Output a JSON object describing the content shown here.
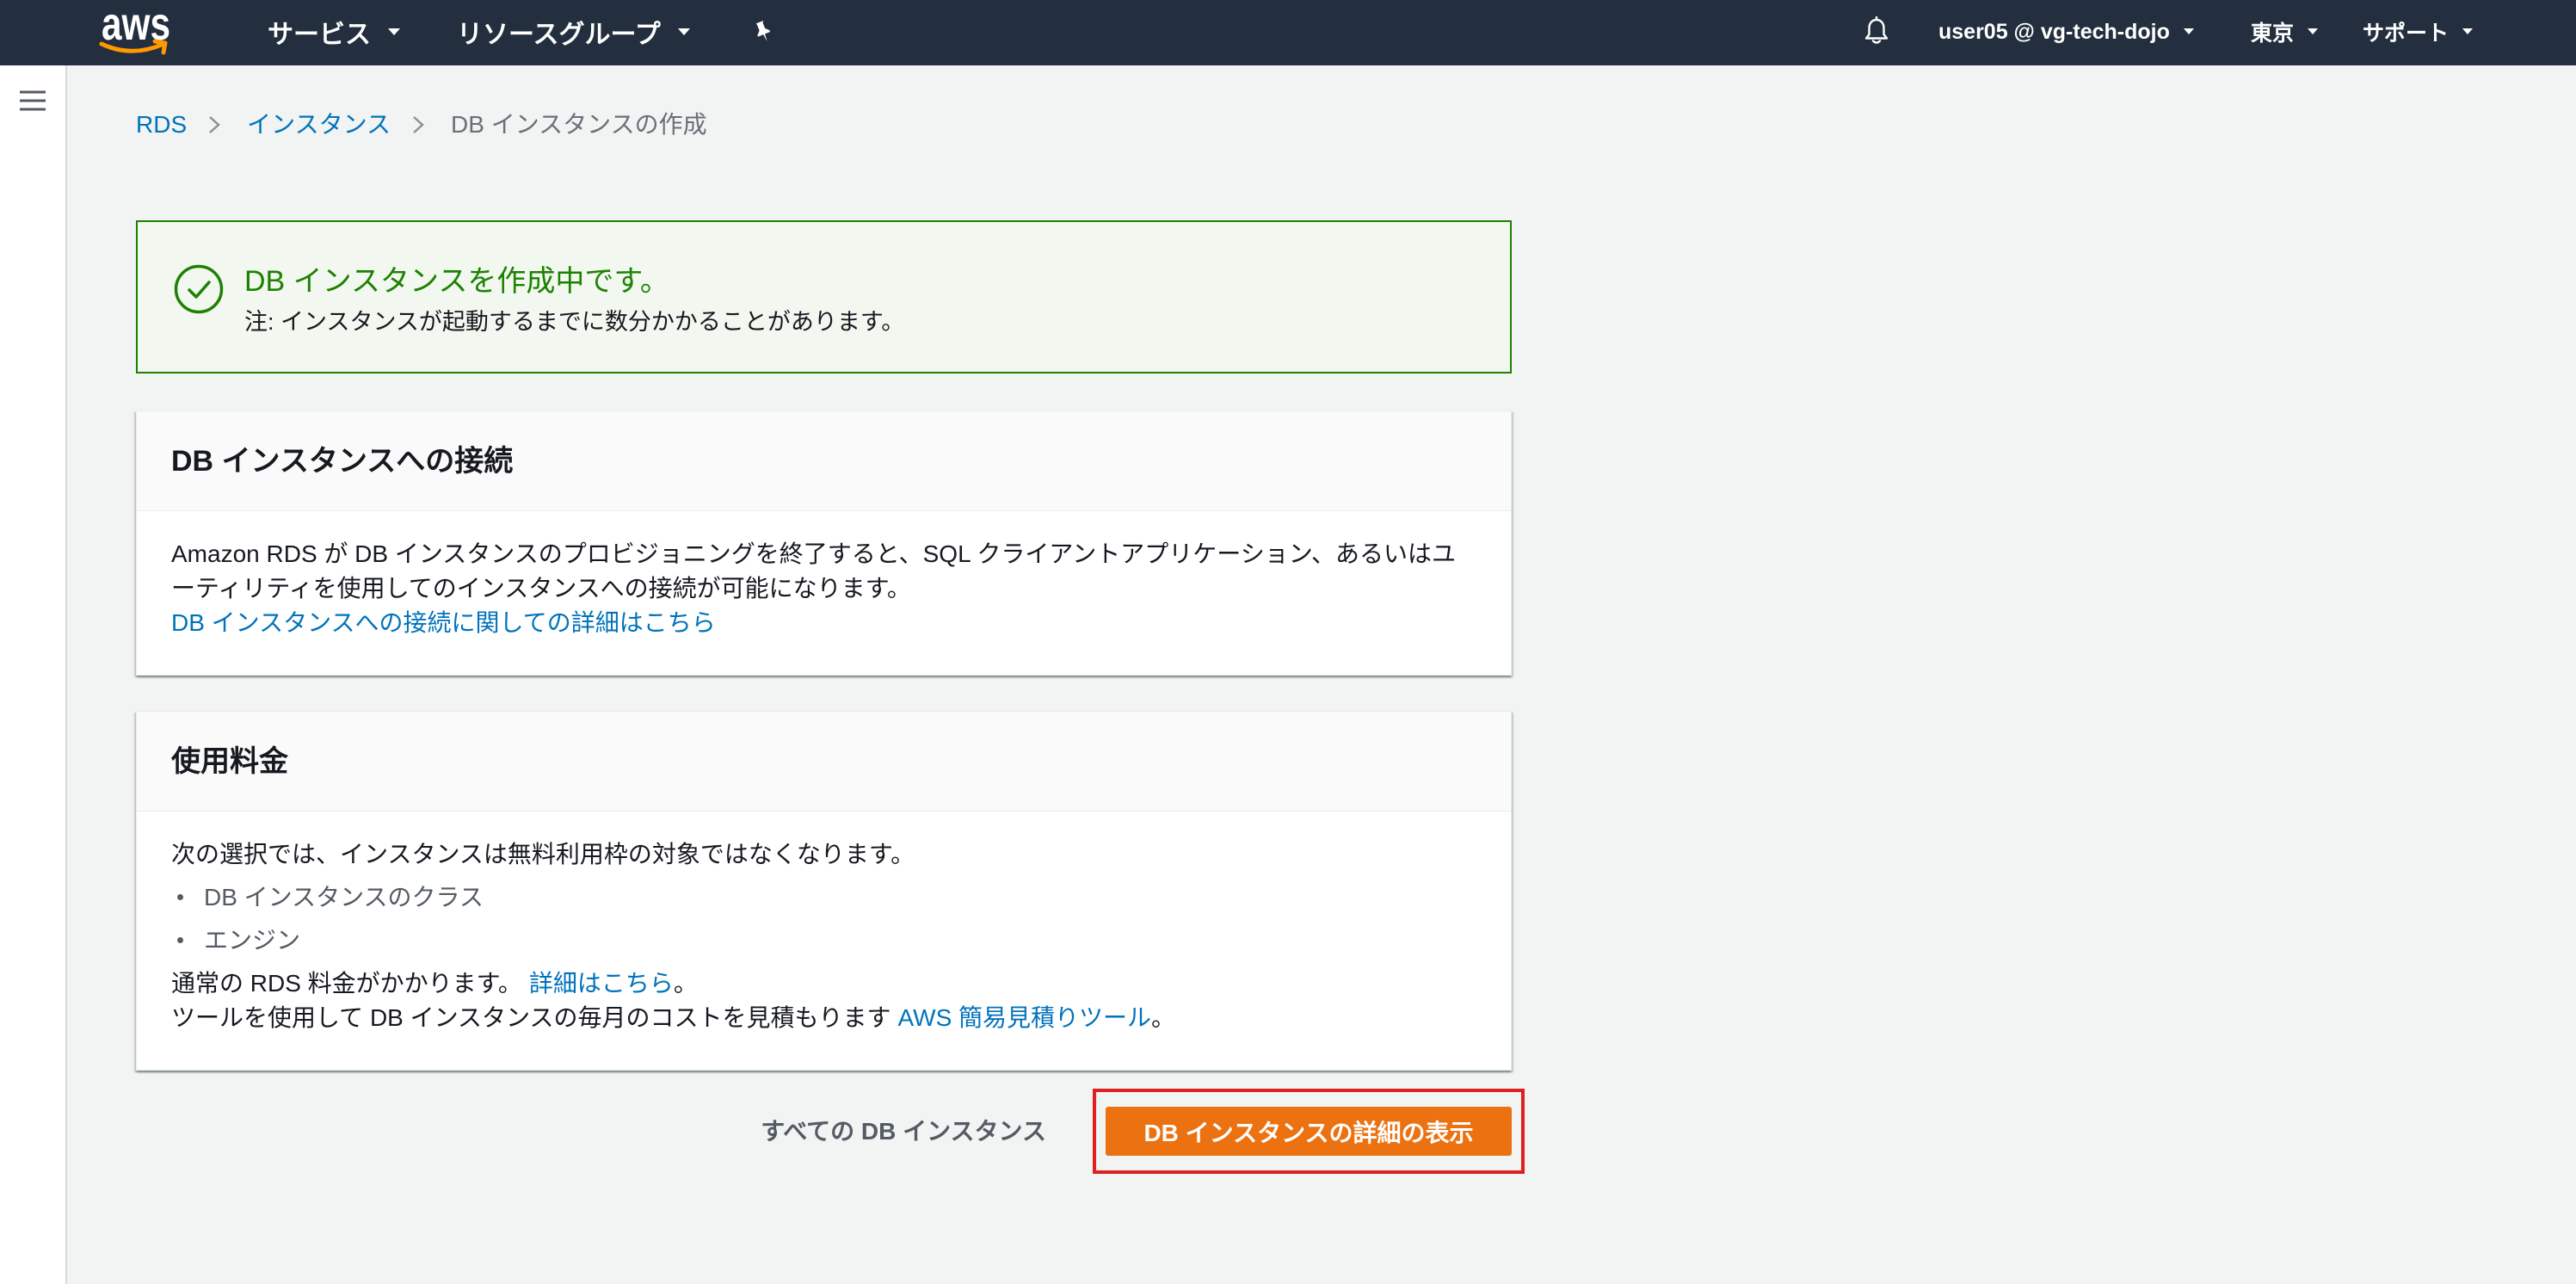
{
  "theme": {
    "nav_background": "#232f3e",
    "page_background": "#f2f3f3",
    "link": "#0073bb",
    "success": "#1d8102",
    "success_background": "#f2f8f0",
    "primary_button": "#ec7211",
    "highlight_border": "#e02020",
    "aws_logo_smile": "#ff9900"
  },
  "nav": {
    "logo_text": "aws",
    "services_label": "サービス",
    "resource_groups_label": "リソースグループ",
    "pin_icon": "pin-icon",
    "notifications_icon": "bell-icon",
    "account_label": "user05 @ vg-tech-dojo",
    "region_label": "東京",
    "support_label": "サポート",
    "dropdown_icon": "caret-down-icon"
  },
  "sidebar": {
    "menu_icon": "hamburger-icon"
  },
  "breadcrumb": {
    "separator_icon": "chevron-right-icon",
    "items": [
      {
        "label": "RDS"
      },
      {
        "label": "インスタンス"
      },
      {
        "label": "DB インスタンスの作成"
      }
    ]
  },
  "alert": {
    "icon": "check-circle-icon",
    "title": "DB インスタンスを作成中です。",
    "message": "注: インスタンスが起動するまでに数分かかることがあります。"
  },
  "connect_panel": {
    "title": "DB インスタンスへの接続",
    "body": "Amazon RDS が DB インスタンスのプロビジョニングを終了すると、SQL クライアントアプリケーション、あるいはユーティリティを使用してのインスタンスへの接続が可能になります。",
    "link": "DB インスタンスへの接続に関しての詳細はこちら"
  },
  "pricing_panel": {
    "title": "使用料金",
    "intro": "次の選択では、インスタンスは無料利用枠の対象ではなくなります。",
    "items": [
      "DB インスタンスのクラス",
      "エンジン"
    ],
    "fees_text": "通常の RDS 料金がかかります。",
    "fees_link": "詳細はこちら",
    "fees_suffix": "。",
    "tool_text": "ツールを使用して DB インスタンスの毎月のコストを見積もります",
    "tool_link": "AWS 簡易見積りツール",
    "tool_suffix": "。"
  },
  "actions": {
    "all_instances_label": "すべての DB インスタンス",
    "view_details_label": "DB インスタンスの詳細の表示"
  }
}
